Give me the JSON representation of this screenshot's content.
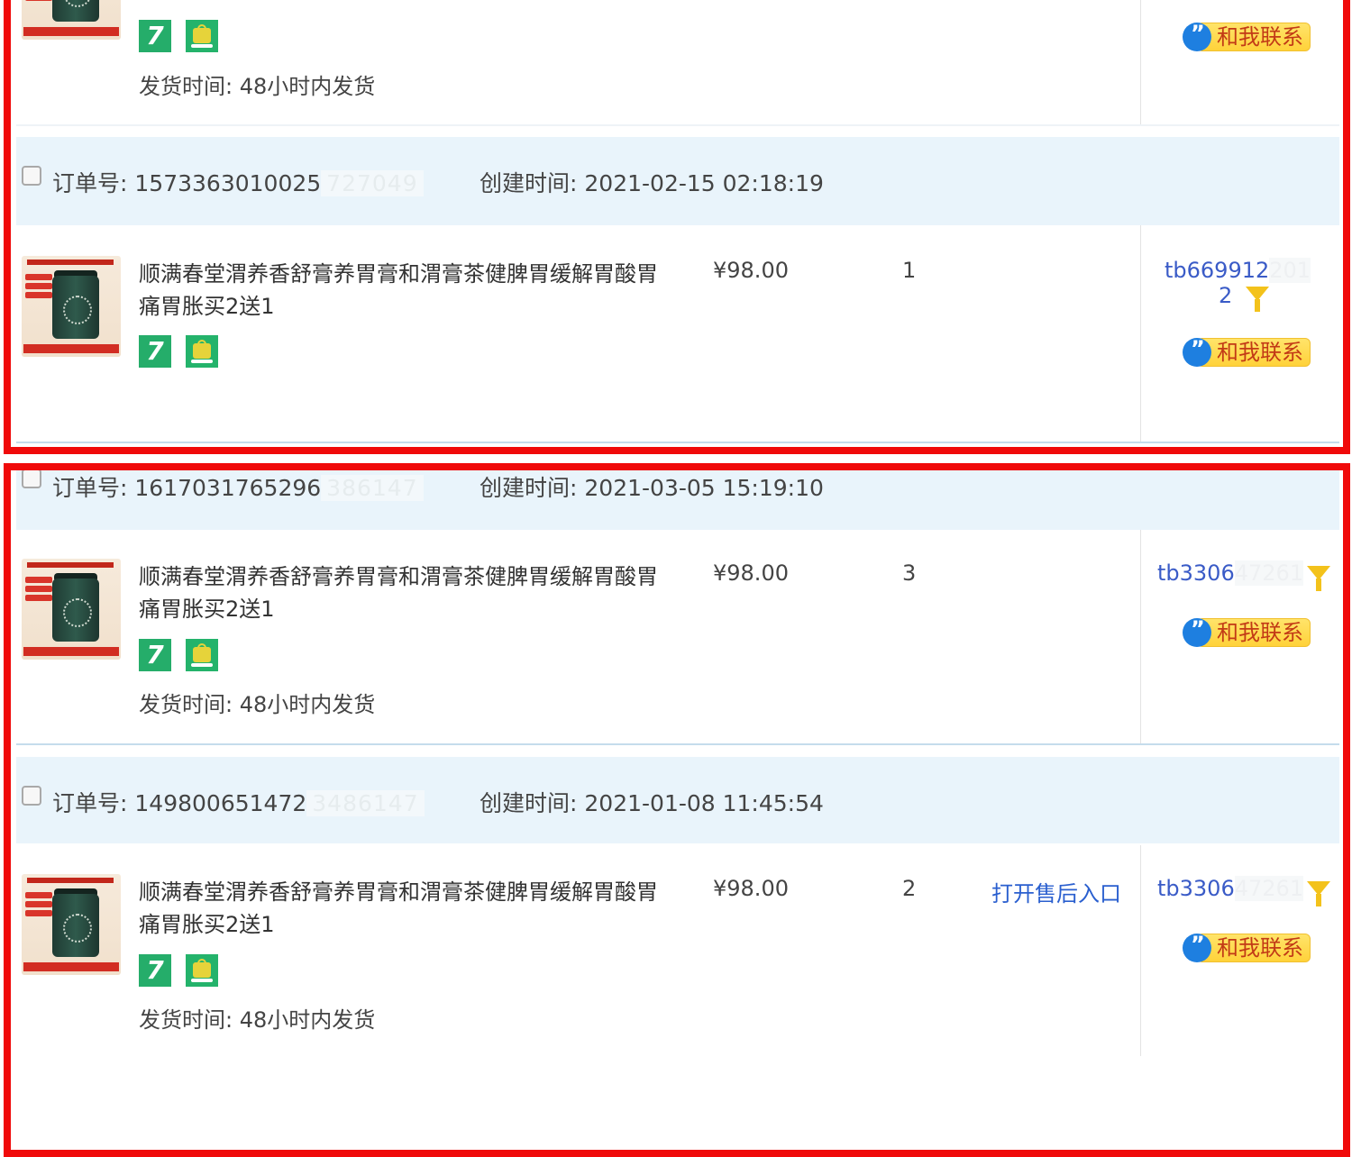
{
  "common": {
    "order_no_label": "订单号:",
    "created_label": "创建时间:",
    "ship_time": "发货时间:  48小时内发货",
    "contact_label": "和我联系",
    "product_title": "顺满春堂渭养香舒膏养胃膏和渭膏茶健脾胃缓解胃酸胃痛胃胀买2送1",
    "badge_seven": "7"
  },
  "top_partial": {
    "ship_time": "发货时间:  48小时内发货",
    "contact_label": "和我联系"
  },
  "orders": [
    {
      "order_no": "1573363010025",
      "order_no_masked": "727049",
      "created": "2021-02-15 02:18:19",
      "price": "¥98.00",
      "qty": "1",
      "buyer": "tb669912",
      "buyer_masked": "201",
      "buyer_line2": "2",
      "after_sale": "",
      "ship_time": ""
    },
    {
      "order_no": "1617031765296",
      "order_no_masked": "386147",
      "created": "2021-03-05 15:19:10",
      "price": "¥98.00",
      "qty": "3",
      "buyer": "tb3306",
      "buyer_masked": "47261",
      "after_sale": "",
      "ship_time": "发货时间:  48小时内发货"
    },
    {
      "order_no": "149800651472",
      "order_no_masked": "3486147",
      "created": "2021-01-08 11:45:54",
      "price": "¥98.00",
      "qty": "2",
      "buyer": "tb3306",
      "buyer_masked": "47261",
      "after_sale": "打开售后入口",
      "ship_time": "发货时间:  48小时内发货"
    }
  ],
  "colors": {
    "highlight_frame": "#f00a0a",
    "header_band": "#e9f4fb",
    "link_blue": "#2a5fcf",
    "badge_green": "#25ad6a",
    "contact_yellow": "#ffd23a"
  },
  "icons": [
    "checkbox-icon",
    "seven-day-return-icon",
    "shopping-bag-icon",
    "filter-flag-icon",
    "chat-bubble-icon"
  ]
}
